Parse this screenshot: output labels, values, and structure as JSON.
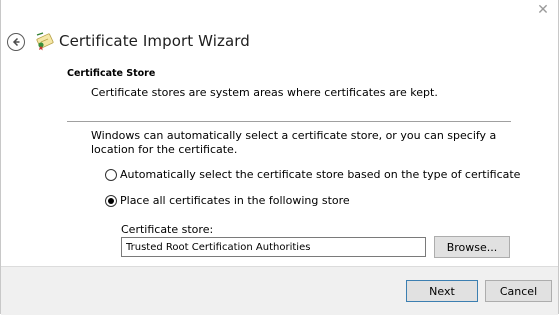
{
  "window": {
    "title": "Certificate Import Wizard",
    "close_glyph": "✕",
    "back_icon": "back-arrow-icon",
    "title_icon": "certificate-icon"
  },
  "section": {
    "heading": "Certificate Store",
    "description": "Certificate stores are system areas where certificates are kept."
  },
  "body": {
    "explanation": "Windows can automatically select a certificate store, or you can specify a location for the certificate.",
    "options": [
      {
        "label": "Automatically select the certificate store based on the type of certificate",
        "selected": false
      },
      {
        "label": "Place all certificates in the following store",
        "selected": true
      }
    ],
    "store_label": "Certificate store:",
    "store_value": "Trusted Root Certification Authorities",
    "browse_label": "Browse..."
  },
  "footer": {
    "next_label": "Next",
    "cancel_label": "Cancel"
  },
  "colors": {
    "accent": "#3c7fb1",
    "button_bg": "#e1e1e1",
    "footer_bg": "#f0f0f0"
  }
}
